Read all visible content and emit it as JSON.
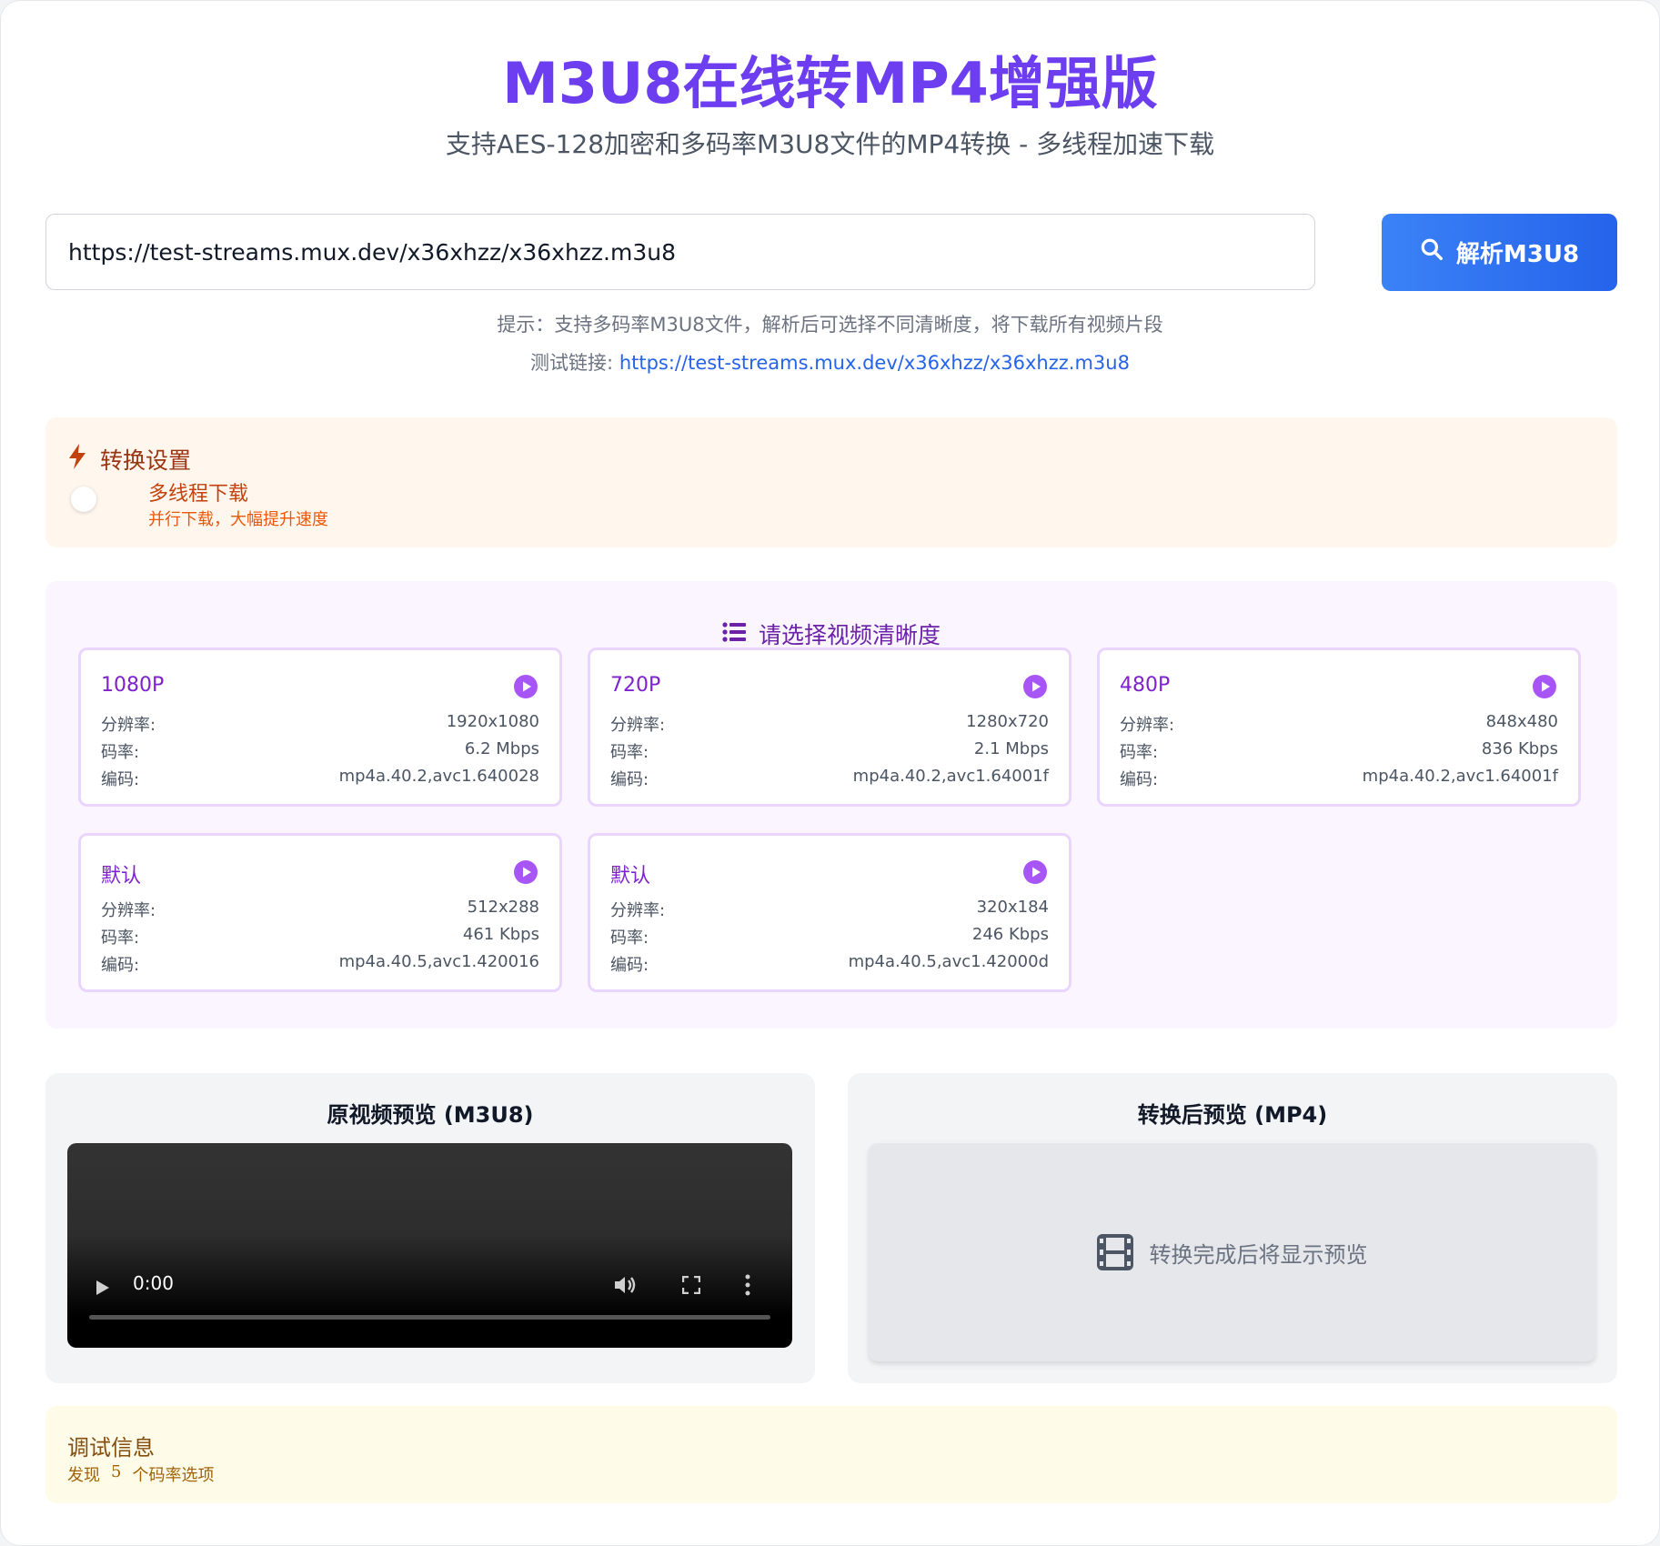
{
  "header": {
    "title": "M3U8在线转MP4增强版",
    "subtitle": "支持AES-128加密和多码率M3U8文件的MP4转换 - 多线程加速下载"
  },
  "search": {
    "value": "https://test-streams.mux.dev/x36xhzz/x36xhzz.m3u8",
    "button_label": "解析M3U8",
    "hint": "提示：支持多码率M3U8文件，解析后可选择不同清晰度，将下载所有视频片段",
    "test_link_label": "测试链接: ",
    "test_link_url": "https://test-streams.mux.dev/x36xhzz/x36xhzz.m3u8"
  },
  "settings": {
    "title": "转换设置",
    "multithread_title": "多线程下载",
    "multithread_desc": "并行下载，大幅提升速度",
    "multithread_enabled": false
  },
  "quality": {
    "title": "请选择视频清晰度",
    "labels": {
      "resolution": "分辨率:",
      "bitrate": "码率:",
      "codec": "编码:"
    },
    "options": [
      {
        "name": "1080P",
        "resolution": "1920x1080",
        "bitrate": "6.2 Mbps",
        "codec": "mp4a.40.2,avc1.640028"
      },
      {
        "name": "720P",
        "resolution": "1280x720",
        "bitrate": "2.1 Mbps",
        "codec": "mp4a.40.2,avc1.64001f"
      },
      {
        "name": "480P",
        "resolution": "848x480",
        "bitrate": "836 Kbps",
        "codec": "mp4a.40.2,avc1.64001f"
      },
      {
        "name": "默认",
        "resolution": "512x288",
        "bitrate": "461 Kbps",
        "codec": "mp4a.40.5,avc1.420016"
      },
      {
        "name": "默认",
        "resolution": "320x184",
        "bitrate": "246 Kbps",
        "codec": "mp4a.40.5,avc1.42000d"
      }
    ]
  },
  "preview": {
    "original_title": "原视频预览 (M3U8)",
    "player_time": "0:00",
    "converted_title": "转换后预览 (MP4)",
    "converted_placeholder": "转换完成后将显示预览"
  },
  "debug": {
    "title": "调试信息",
    "prefix": "发现",
    "count": "5",
    "suffix": "个码率选项"
  },
  "colors": {
    "accent": "#6d3ef0",
    "button": "#2563eb",
    "quality_name": "#7e22ce",
    "settings_bg": "#fff7ed",
    "debug_bg": "#fefce8"
  }
}
